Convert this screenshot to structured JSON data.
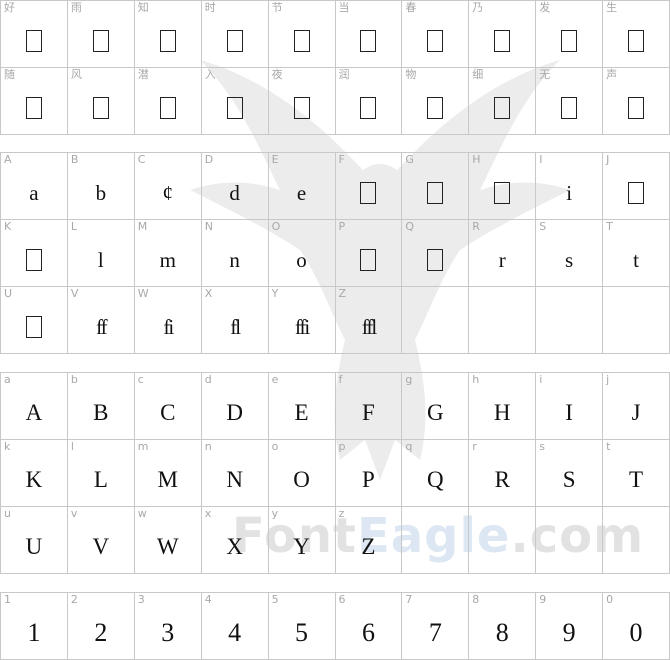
{
  "watermark": {
    "text_part1": "Font",
    "text_part2": "Eagle",
    "text_part3": ".com"
  },
  "sections": [
    {
      "id": "cjk",
      "cells": [
        {
          "key": "好",
          "glyph": "",
          "missing": true
        },
        {
          "key": "雨",
          "glyph": "",
          "missing": true
        },
        {
          "key": "知",
          "glyph": "",
          "missing": true
        },
        {
          "key": "时",
          "glyph": "",
          "missing": true
        },
        {
          "key": "节",
          "glyph": "",
          "missing": true
        },
        {
          "key": "当",
          "glyph": "",
          "missing": true
        },
        {
          "key": "春",
          "glyph": "",
          "missing": true
        },
        {
          "key": "乃",
          "glyph": "",
          "missing": true
        },
        {
          "key": "发",
          "glyph": "",
          "missing": true
        },
        {
          "key": "生",
          "glyph": "",
          "missing": true
        },
        {
          "key": "随",
          "glyph": "",
          "missing": true
        },
        {
          "key": "风",
          "glyph": "",
          "missing": true
        },
        {
          "key": "潜",
          "glyph": "",
          "missing": true
        },
        {
          "key": "入",
          "glyph": "",
          "missing": true
        },
        {
          "key": "夜",
          "glyph": "",
          "missing": true
        },
        {
          "key": "润",
          "glyph": "",
          "missing": true
        },
        {
          "key": "物",
          "glyph": "",
          "missing": true
        },
        {
          "key": "细",
          "glyph": "",
          "missing": true
        },
        {
          "key": "无",
          "glyph": "",
          "missing": true
        },
        {
          "key": "声",
          "glyph": "",
          "missing": true
        }
      ]
    },
    {
      "id": "lower",
      "cells": [
        {
          "key": "A",
          "glyph": "a"
        },
        {
          "key": "B",
          "glyph": "b"
        },
        {
          "key": "C",
          "glyph": "¢"
        },
        {
          "key": "D",
          "glyph": "d"
        },
        {
          "key": "E",
          "glyph": "e"
        },
        {
          "key": "F",
          "glyph": "",
          "missing": true
        },
        {
          "key": "G",
          "glyph": "",
          "missing": true
        },
        {
          "key": "H",
          "glyph": "",
          "missing": true
        },
        {
          "key": "I",
          "glyph": "i"
        },
        {
          "key": "J",
          "glyph": "",
          "missing": true
        },
        {
          "key": "K",
          "glyph": "",
          "missing": true
        },
        {
          "key": "L",
          "glyph": "l"
        },
        {
          "key": "M",
          "glyph": "m"
        },
        {
          "key": "N",
          "glyph": "n"
        },
        {
          "key": "O",
          "glyph": "o"
        },
        {
          "key": "P",
          "glyph": "",
          "missing": true
        },
        {
          "key": "Q",
          "glyph": "",
          "missing": true
        },
        {
          "key": "R",
          "glyph": "r"
        },
        {
          "key": "S",
          "glyph": "s"
        },
        {
          "key": "T",
          "glyph": "t"
        },
        {
          "key": "U",
          "glyph": "",
          "missing": true
        },
        {
          "key": "V",
          "glyph": "ff",
          "lig": true
        },
        {
          "key": "W",
          "glyph": "fi",
          "lig": true
        },
        {
          "key": "X",
          "glyph": "fl",
          "lig": true
        },
        {
          "key": "Y",
          "glyph": "ffi",
          "lig": true
        },
        {
          "key": "Z",
          "glyph": "ffl",
          "lig": true
        },
        {
          "key": "",
          "glyph": ""
        },
        {
          "key": "",
          "glyph": ""
        },
        {
          "key": "",
          "glyph": ""
        },
        {
          "key": "",
          "glyph": ""
        }
      ]
    },
    {
      "id": "upper",
      "cells": [
        {
          "key": "a",
          "glyph": "A"
        },
        {
          "key": "b",
          "glyph": "B"
        },
        {
          "key": "c",
          "glyph": "C"
        },
        {
          "key": "d",
          "glyph": "D"
        },
        {
          "key": "e",
          "glyph": "E"
        },
        {
          "key": "f",
          "glyph": "F"
        },
        {
          "key": "g",
          "glyph": "G"
        },
        {
          "key": "h",
          "glyph": "H"
        },
        {
          "key": "i",
          "glyph": "I"
        },
        {
          "key": "j",
          "glyph": "J"
        },
        {
          "key": "k",
          "glyph": "K"
        },
        {
          "key": "l",
          "glyph": "L"
        },
        {
          "key": "m",
          "glyph": "M"
        },
        {
          "key": "n",
          "glyph": "N"
        },
        {
          "key": "o",
          "glyph": "O"
        },
        {
          "key": "p",
          "glyph": "P"
        },
        {
          "key": "q",
          "glyph": "Q"
        },
        {
          "key": "r",
          "glyph": "R"
        },
        {
          "key": "s",
          "glyph": "S"
        },
        {
          "key": "t",
          "glyph": "T"
        },
        {
          "key": "u",
          "glyph": "U"
        },
        {
          "key": "v",
          "glyph": "V"
        },
        {
          "key": "w",
          "glyph": "W"
        },
        {
          "key": "x",
          "glyph": "X"
        },
        {
          "key": "y",
          "glyph": "Y"
        },
        {
          "key": "z",
          "glyph": "Z"
        },
        {
          "key": "",
          "glyph": ""
        },
        {
          "key": "",
          "glyph": ""
        },
        {
          "key": "",
          "glyph": ""
        },
        {
          "key": "",
          "glyph": ""
        }
      ]
    },
    {
      "id": "digits",
      "cells": [
        {
          "key": "1",
          "glyph": "1"
        },
        {
          "key": "2",
          "glyph": "2"
        },
        {
          "key": "3",
          "glyph": "3"
        },
        {
          "key": "4",
          "glyph": "4"
        },
        {
          "key": "5",
          "glyph": "5"
        },
        {
          "key": "6",
          "glyph": "6"
        },
        {
          "key": "7",
          "glyph": "7"
        },
        {
          "key": "8",
          "glyph": "8"
        },
        {
          "key": "9",
          "glyph": "9"
        },
        {
          "key": "0",
          "glyph": "0"
        }
      ]
    }
  ]
}
